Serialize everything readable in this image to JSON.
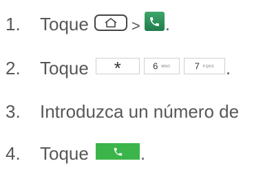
{
  "steps": [
    {
      "number": "1.",
      "text": "Toque",
      "separator": ">",
      "trailing": ".",
      "icons": [
        "home-key-icon",
        "phone-app-icon"
      ]
    },
    {
      "number": "2.",
      "text": "Toque",
      "trailing": ".",
      "keys": [
        {
          "label": "*"
        },
        {
          "digit": "6",
          "letters": "MNO"
        },
        {
          "digit": "7",
          "letters": "PQRS"
        }
      ]
    },
    {
      "number": "3.",
      "text": "Introduzca un número de"
    },
    {
      "number": "4.",
      "text": "Toque",
      "trailing": ".",
      "icons": [
        "call-button-icon"
      ]
    }
  ],
  "colors": {
    "text": "#575757",
    "phone_app_green": "#2a8d56",
    "call_button_green": "#3bb54a"
  }
}
